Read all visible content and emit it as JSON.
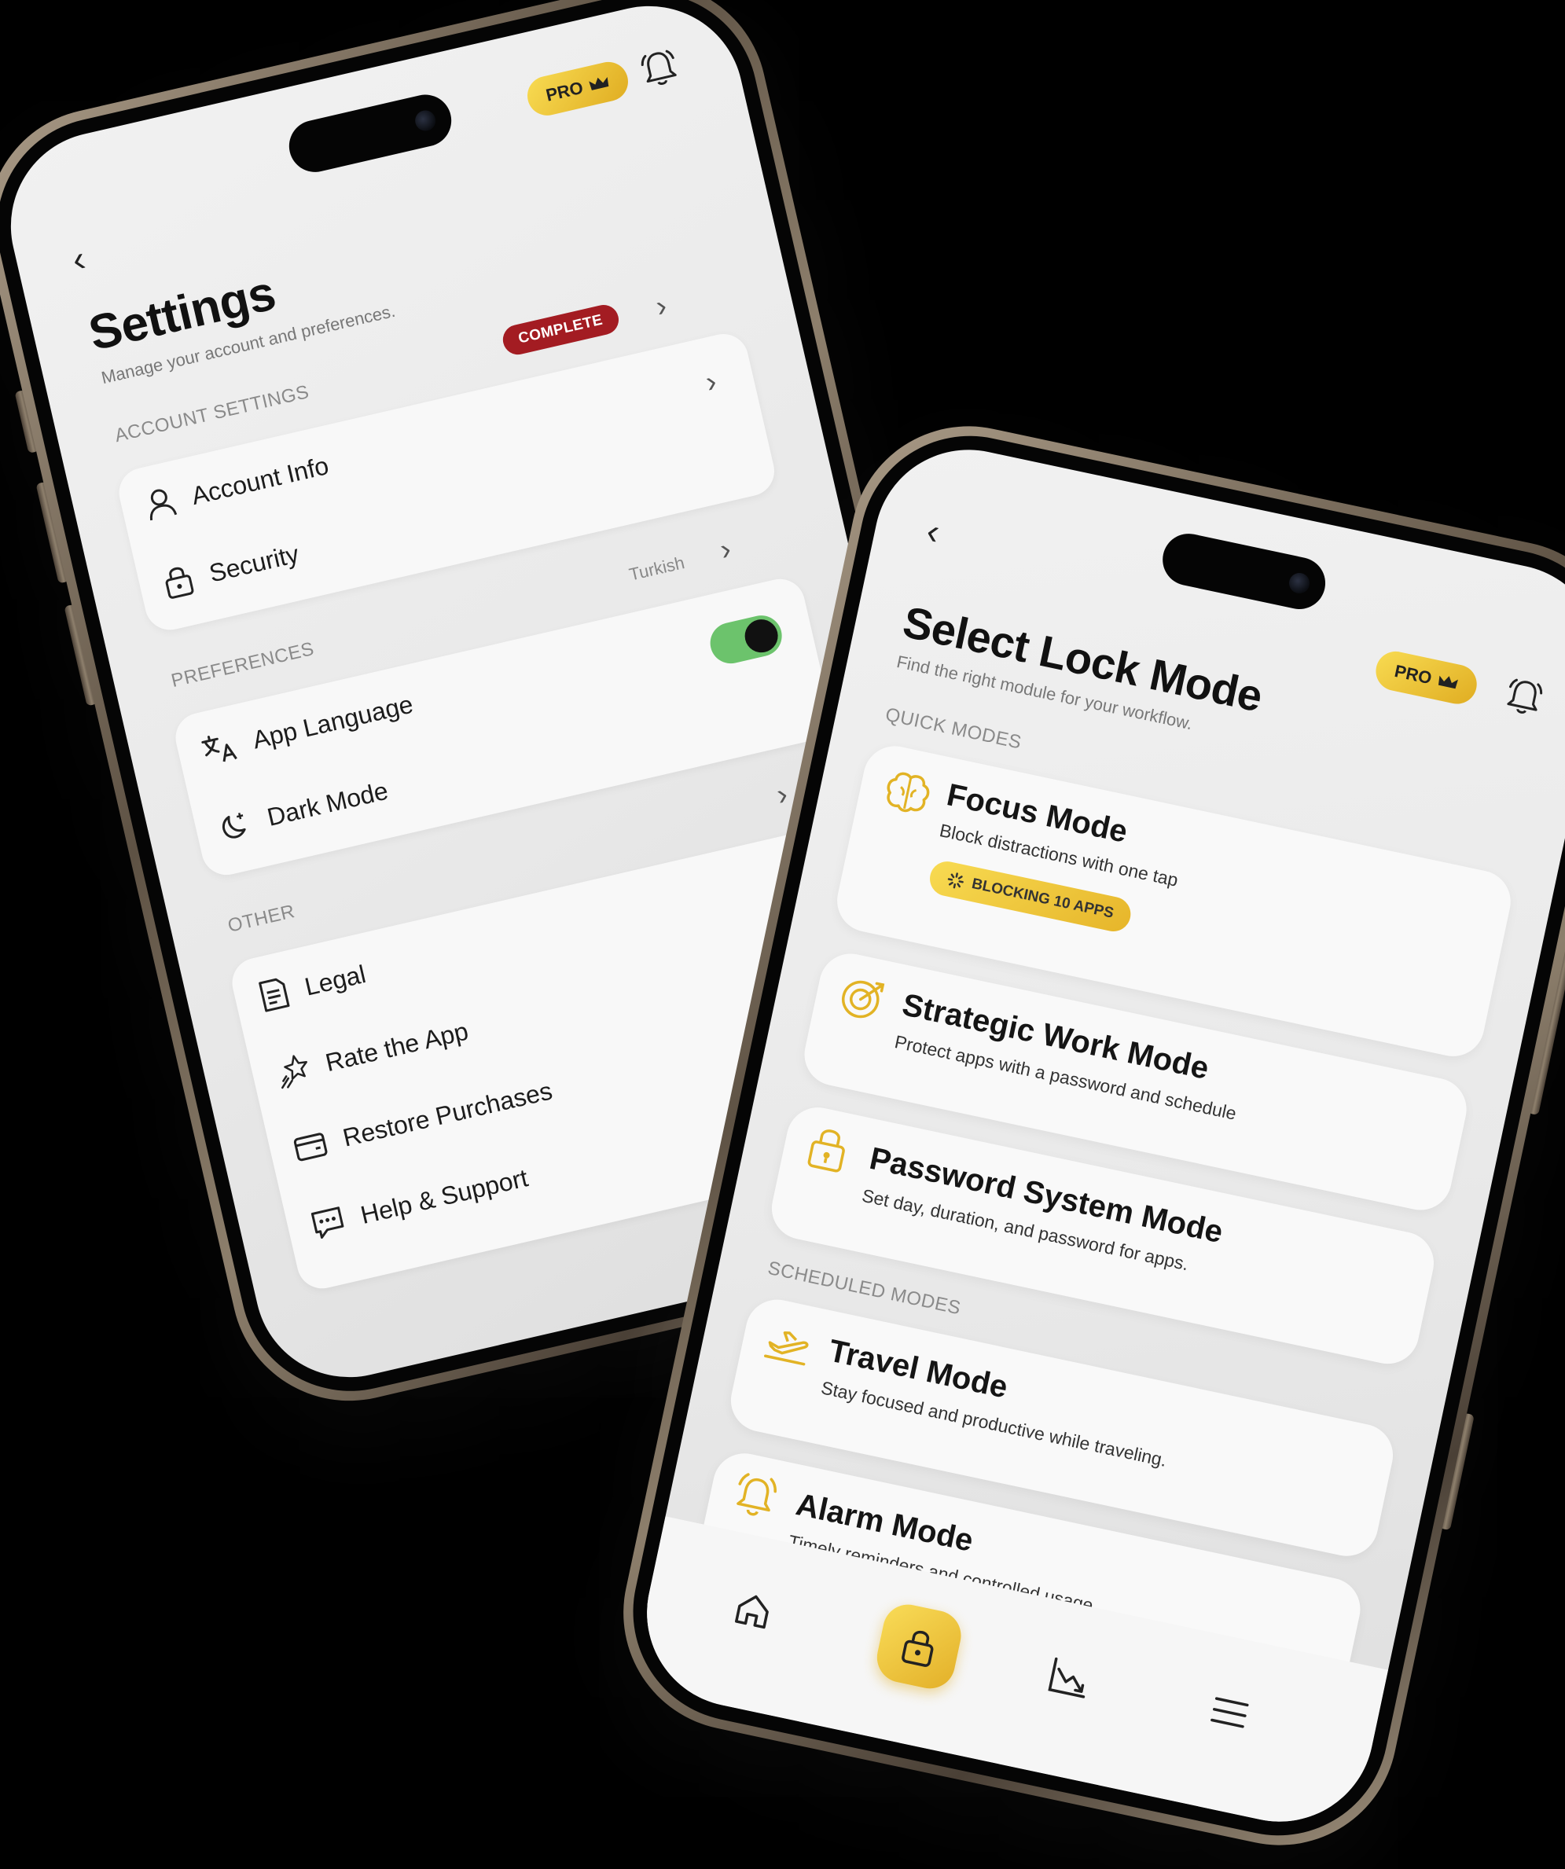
{
  "settings_screen": {
    "pro_badge": "PRO",
    "title": "Settings",
    "subtitle": "Manage your account and preferences.",
    "account_section": "ACCOUNT SETTINGS",
    "account_badge": "COMPLETE",
    "account_items": [
      {
        "label": "Account Info",
        "icon": "user-icon"
      },
      {
        "label": "Security",
        "icon": "lock-icon"
      }
    ],
    "preferences_section": "PREFERENCES",
    "language_value": "Turkish",
    "preferences_items": [
      {
        "label": "App Language",
        "icon": "translate-icon"
      },
      {
        "label": "Dark Mode",
        "icon": "moon-icon",
        "toggle_on": true
      }
    ],
    "other_section": "OTHER",
    "other_items": [
      {
        "label": "Legal",
        "icon": "document-icon"
      },
      {
        "label": "Rate the App",
        "icon": "star-icon"
      },
      {
        "label": "Restore Purchases",
        "icon": "wallet-icon"
      },
      {
        "label": "Help & Support",
        "icon": "chat-icon"
      }
    ]
  },
  "lock_screen": {
    "pro_badge": "PRO",
    "title": "Select Lock Mode",
    "subtitle": "Find the right module for your workflow.",
    "quick_section": "QUICK MODES",
    "quick_modes": [
      {
        "title": "Focus Mode",
        "desc": "Block distractions with one tap",
        "badge": "BLOCKING 10 APPS",
        "icon": "brain-icon"
      },
      {
        "title": "Strategic Work Mode",
        "desc": "Protect apps with a password and  schedule",
        "icon": "target-icon"
      },
      {
        "title": "Password System Mode",
        "desc": "Set day, duration, and password for apps.",
        "icon": "padlock-icon"
      }
    ],
    "scheduled_section": "SCHEDULED MODES",
    "scheduled_modes": [
      {
        "title": "Travel Mode",
        "desc": "Stay focused and productive while traveling.",
        "icon": "plane-icon"
      },
      {
        "title": "Alarm Mode",
        "desc": "Timely reminders and controlled usage.",
        "icon": "alarm-icon"
      }
    ],
    "tabs": [
      "home-icon",
      "lock-icon",
      "chart-icon",
      "menu-icon"
    ]
  },
  "colors": {
    "accent": "#F2C935",
    "toggle_on": "#6CC36C",
    "badge_red": "#A31C22",
    "frame": "#7A6C5A"
  }
}
